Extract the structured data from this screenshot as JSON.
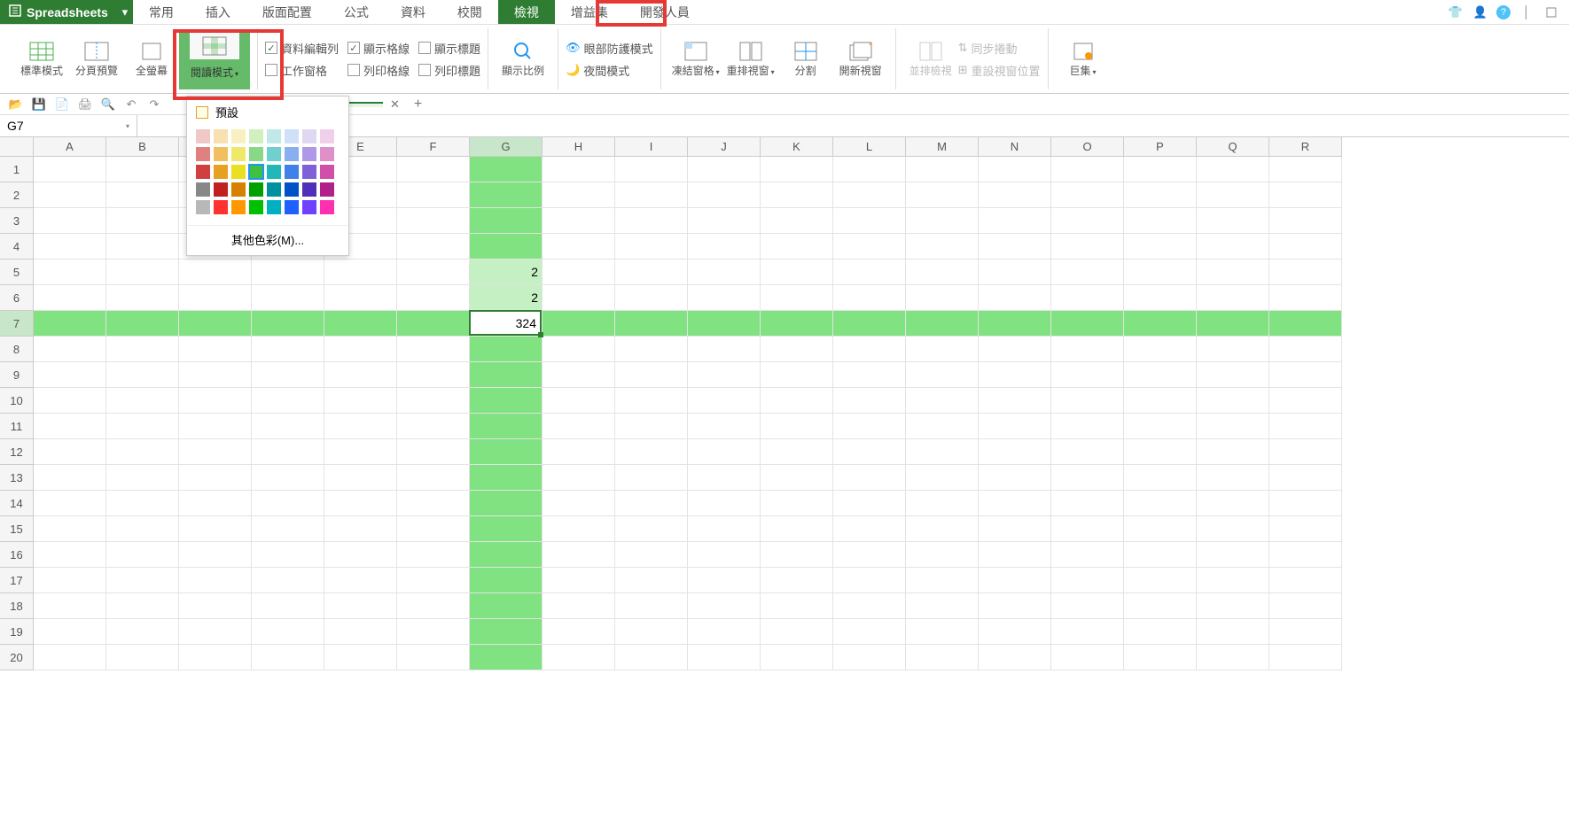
{
  "app": {
    "name": "Spreadsheets"
  },
  "menu": {
    "tabs": [
      "常用",
      "插入",
      "版面配置",
      "公式",
      "資料",
      "校閱",
      "檢視",
      "增益集",
      "開發人員"
    ],
    "active": "檢視"
  },
  "ribbon": {
    "normal": "標準模式",
    "page_preview": "分頁預覽",
    "fullscreen": "全螢幕",
    "reading_mode": "閱讀模式",
    "formula_bar": "資料編輯列",
    "task_pane": "工作窗格",
    "show_grid": "顯示格線",
    "print_grid": "列印格線",
    "show_headings": "顯示標題",
    "print_headings": "列印標題",
    "zoom": "顯示比例",
    "eye_protect": "眼部防護模式",
    "night_mode": "夜間模式",
    "freeze": "凍結窗格",
    "arrange": "重排視窗",
    "split": "分割",
    "new_window": "開新視窗",
    "side_by_side": "並排檢視",
    "sync_scroll": "同步捲動",
    "reset_pos": "重設視窗位置",
    "macros": "巨集"
  },
  "color_popup": {
    "default": "預設",
    "more_colors": "其他色彩(M)...",
    "palette": [
      [
        "#f0c8c8",
        "#f8e0b0",
        "#f8f0c0",
        "#d0f0c0",
        "#c0e8e8",
        "#d0e0f8",
        "#e0d8f0",
        "#f0d0e8"
      ],
      [
        "#e08080",
        "#f0c060",
        "#f0e868",
        "#88d888",
        "#70d0d0",
        "#88b0f0",
        "#b098e8",
        "#e090c8"
      ],
      [
        "#d04040",
        "#e8a020",
        "#e8e020",
        "#40c040",
        "#20b8b8",
        "#4080e8",
        "#8060d8",
        "#d050a8"
      ],
      [
        "#888888",
        "#c02020",
        "#d88000",
        "#00a000",
        "#0090a0",
        "#0050c8",
        "#5030b8",
        "#b02088"
      ],
      [
        "#b8b8b8",
        "#ff3030",
        "#ff9800",
        "#00c000",
        "#00b0c0",
        "#2060ff",
        "#7040ff",
        "#ff30b0"
      ]
    ],
    "selected_row": 2,
    "selected_col": 3
  },
  "namebox": {
    "ref": "G7"
  },
  "grid": {
    "cols": [
      "A",
      "B",
      "C",
      "D",
      "E",
      "F",
      "G",
      "H",
      "I",
      "J",
      "K",
      "L",
      "M",
      "N",
      "O",
      "P",
      "Q",
      "R"
    ],
    "rows": 20,
    "reading_col": "G",
    "reading_row": 7,
    "cells": {
      "G5": "2",
      "G6": "2",
      "G7": "324"
    },
    "selected": "G7"
  }
}
